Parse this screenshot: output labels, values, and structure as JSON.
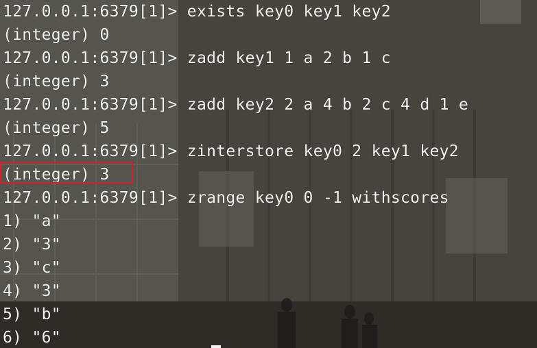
{
  "terminal": {
    "lines": [
      "127.0.0.1:6379[1]> exists key0 key1 key2",
      "(integer) 0",
      "127.0.0.1:6379[1]> zadd key1 1 a 2 b 1 c",
      "(integer) 3",
      "127.0.0.1:6379[1]> zadd key2 2 a 4 b 2 c 4 d 1 e",
      "(integer) 5",
      "127.0.0.1:6379[1]> zinterstore key0 2 key1 key2",
      "(integer) 3",
      "127.0.0.1:6379[1]> zrange key0 0 -1 withscores",
      "1) \"a\"",
      "2) \"3\"",
      "3) \"c\"",
      "4) \"3\"",
      "5) \"b\"",
      "6) \"6\""
    ],
    "highlighted_line_index": 7
  },
  "colors": {
    "text": "#f2f2f2",
    "highlight_border": "#d4202a"
  }
}
